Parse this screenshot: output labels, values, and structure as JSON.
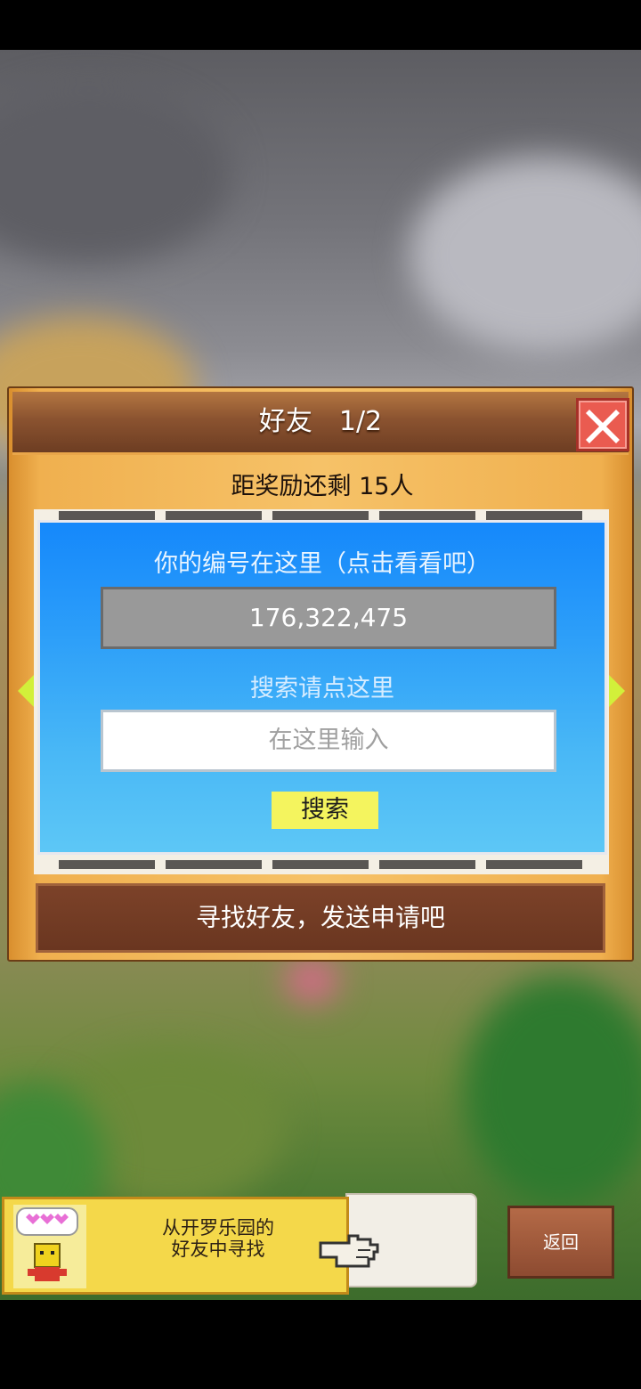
{
  "dialog": {
    "title": "好友　1/2",
    "reward_text": "距奖励还剩 15人",
    "id_label": "你的编号在这里（点击看看吧）",
    "player_id": "176,322,475",
    "search_label": "搜索请点这里",
    "search_placeholder": "在这里输入",
    "search_button": "搜索",
    "find_button": "寻找好友，发送申请吧"
  },
  "banner": {
    "line1": "从开罗乐园的",
    "line2": "好友中寻找"
  },
  "back_button": "返回",
  "icons": [
    "close-icon",
    "arrow-left-icon",
    "arrow-right-icon",
    "heart-bubble-icon",
    "character-icon",
    "pointing-hand-icon"
  ],
  "colors": {
    "panel_wood": "#f0b04f",
    "title_bar": "#8b5330",
    "blue_panel": "#2d9ff9",
    "search_button": "#f4f45e",
    "close_red": "#ea5b50"
  }
}
